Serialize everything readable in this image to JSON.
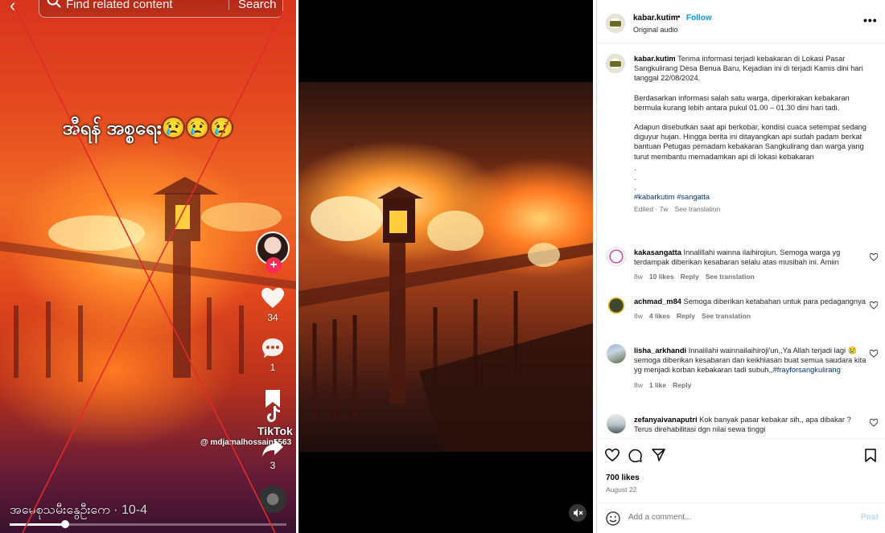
{
  "tiktok": {
    "search_placeholder": "Find related content",
    "search_button": "Search",
    "caption": "အီရန် အစ္စရေး😢😢😢",
    "likes": "34",
    "comments": "1",
    "shares": "3",
    "logo_text": "TikTok",
    "handle": "@ mdjamalhossain5563",
    "bottom_text": "အမေစုသမီးနွေဦးကေ",
    "bottom_date": " · 10-4",
    "progress": 0.2,
    "accent": "#fe2c55"
  },
  "instagram": {
    "username": "kabar.kutim",
    "dot": "•",
    "follow": "Follow",
    "audio": "Original audio",
    "caption_user": "kabar.kutim",
    "caption_p1": "Terima informasi terjadi kebakaran di Lokasi Pasar Sangkulirang Desa Benua Baru, Kejadian ini di terjadi Kamis dini hari tanggal 22/08/2024.",
    "caption_p2": "Berdasarkan informasi salah satu warga, diperkirakan kebakaran bermula kurang lebih antara pukul 01.00 – 01.30 dini hari tadi.",
    "caption_p3": "Adapun disebutkan saat api berkobar, kondisi cuaca setempat sedang diguyur hujan. Hingga berita ini ditayangkan api sudah padam berkat bantuan Petugas pemadam kebakaran Sangkulirang dan warga yang turut membantu memadamkan api di lokasi kebakaran",
    "caption_dots": ".",
    "hashtags": "#kabarkutim #sangatta",
    "caption_meta_time": "Edited · 7w",
    "see_translation": "See translation",
    "reply": "Reply",
    "comments": [
      {
        "user": "kakasangatta",
        "text": "Innalillahi wainna ilaihirojiun. Semoga warga yg terdampak diberikan kesabaran selalu atas musibah ini. Amiin",
        "time": "8w",
        "likes": "10 likes"
      },
      {
        "user": "achmad_m84",
        "text": "Semoga diberikan ketabahan untuk para pedagangnya",
        "time": "8w",
        "likes": "4 likes"
      },
      {
        "user": "lisha_arkhandi",
        "text": "Innalilahi wainnailaihiroji'un,,Ya Allah terjadi lagi 😢 semoga diberikan kesabaran dan keikhlasan buat semua saudara kita yg menjadi korban kebakaran tadi subuh,,",
        "tag": "#frayforsangkulirang",
        "time": "8w",
        "likes": "1 like"
      },
      {
        "user": "zefanyaivanaputri",
        "text": "Kok banyak pasar kebakar sih,, apa dibakar ? Terus direhabilitasi dgn nilai sewa tinggi"
      }
    ],
    "likes_total": "700 likes",
    "post_date": "August 22",
    "add_comment": "Add a comment...",
    "post_button": "Post",
    "link_color": "#0095f6"
  }
}
